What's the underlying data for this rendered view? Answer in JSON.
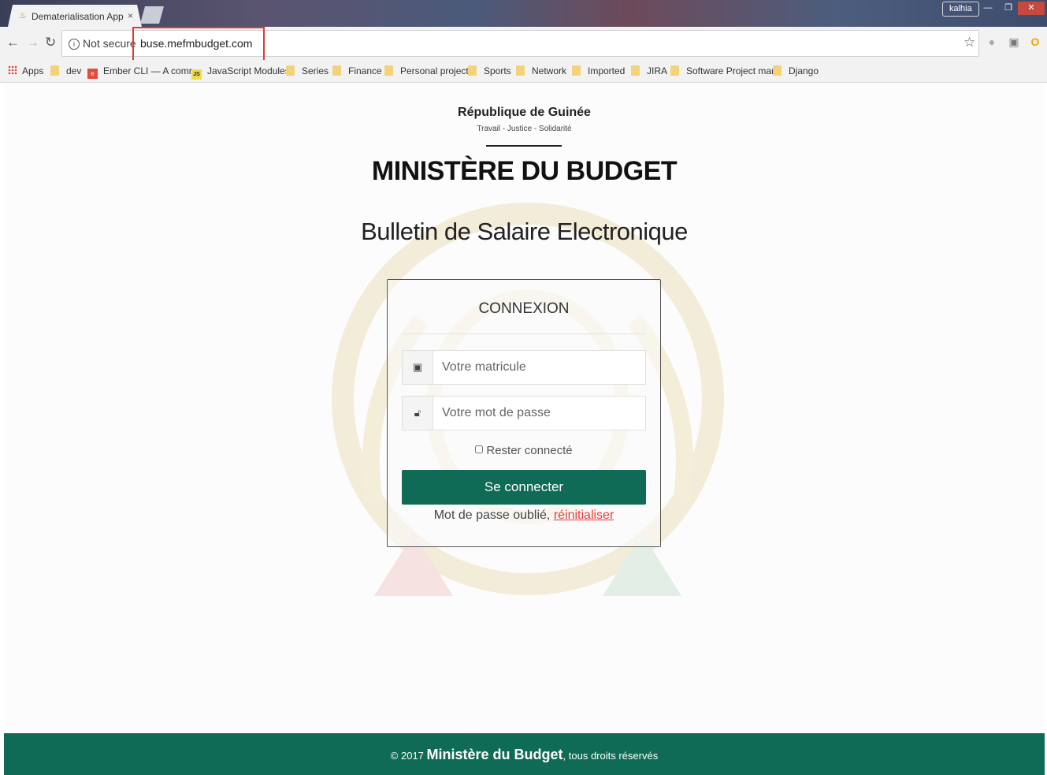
{
  "browser": {
    "tab_title": "Dematerialisation App",
    "tab_close": "×",
    "user_badge": "kalhia",
    "window_controls": [
      "—",
      "❐",
      "✕"
    ],
    "security_label": "Not secure",
    "url": "buse.mefmbudget.com",
    "bookmarks": [
      {
        "label": "Apps",
        "icon": "apps-grid-icon"
      },
      {
        "label": "dev",
        "icon": "folder-icon"
      },
      {
        "label": "Ember CLI — A comr",
        "icon": "ember-icon"
      },
      {
        "label": "JavaScript Modules",
        "icon": "js-icon"
      },
      {
        "label": "Series",
        "icon": "folder-icon"
      },
      {
        "label": "Finance",
        "icon": "folder-icon"
      },
      {
        "label": "Personal project",
        "icon": "folder-icon"
      },
      {
        "label": "Sports",
        "icon": "folder-icon"
      },
      {
        "label": "Network",
        "icon": "folder-icon"
      },
      {
        "label": "Imported",
        "icon": "folder-icon"
      },
      {
        "label": "JIRA",
        "icon": "folder-icon"
      },
      {
        "label": "Software Project mar",
        "icon": "folder-icon"
      },
      {
        "label": "Django",
        "icon": "folder-icon"
      }
    ]
  },
  "header": {
    "country": "République de Guinée",
    "motto": "Travail - Justice - Solidarité",
    "ministry": "MINISTÈRE DU BUDGET"
  },
  "app_title": "Bulletin de Salaire Electronique",
  "login": {
    "title": "CONNEXION",
    "matricule_placeholder": "Votre matricule",
    "password_placeholder": "Votre mot de passe",
    "remember_label": "Rester connecté",
    "submit_label": "Se connecter",
    "forgot_text": "Mot de passe oublié, ",
    "reset_link": "réinitialiser"
  },
  "footer": {
    "prefix": "© 2017 ",
    "ministry": "Ministère du Budget",
    "suffix": ", tous droits réservés"
  },
  "colors": {
    "brand_green": "#0f6b55",
    "link_red": "#e53935",
    "highlight_red": "#e53935"
  }
}
